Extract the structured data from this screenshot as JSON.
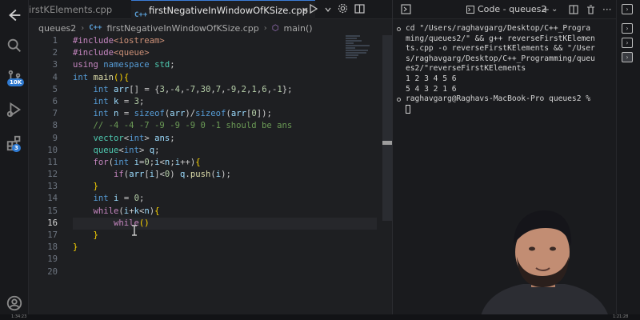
{
  "tabs": {
    "inactive_label": "irstKElements.cpp",
    "active_label": "firstNegativeInWindowOfKSize.cpp",
    "active_icon": "C++",
    "close_glyph": "×"
  },
  "breadcrumb": {
    "folder": "queues2",
    "file": "firstNegativeInWindowOfKSize.cpp",
    "symbol": "main()"
  },
  "activity": {
    "source_control_badge": "10K",
    "extensions_badge": "3"
  },
  "editor": {
    "current_line": 16,
    "line_numbers": [
      "1",
      "2",
      "3",
      "4",
      "5",
      "6",
      "7",
      "8",
      "9",
      "10",
      "11",
      "12",
      "13",
      "14",
      "15",
      "16",
      "17",
      "18",
      "19",
      "20"
    ]
  },
  "panel": {
    "title": "Code - queues2",
    "add_glyph": "+",
    "chevron_glyph": "⌄",
    "split_glyph": "◫",
    "trash_glyph": "🗑",
    "more_glyph": "···",
    "lines": [
      "cd \"/Users/raghavgarg/Desktop/C++_Progra",
      "ming/queues2/\" && g++ reverseFirstKElemen",
      "ts.cpp -o reverseFirstKElements && \"/User",
      "s/raghavgarg/Desktop/C++_Programming/queu",
      "es2/\"reverseFirstKElements",
      "1 2 3 4 5 6",
      "5 4 3 2 1 6",
      "raghavgarg@Raghavs-MacBook-Pro queues2 %"
    ]
  },
  "timeline": {
    "left_time": "1:34:23",
    "right_time": "1:21:28"
  },
  "colors": {
    "accent": "#3a7bd5",
    "keyword": "#569cd6",
    "type": "#4ec9b0",
    "preprocessor": "#c586c0",
    "function": "#dcdcaa",
    "number": "#b5cea8",
    "comment": "#6a9955"
  }
}
